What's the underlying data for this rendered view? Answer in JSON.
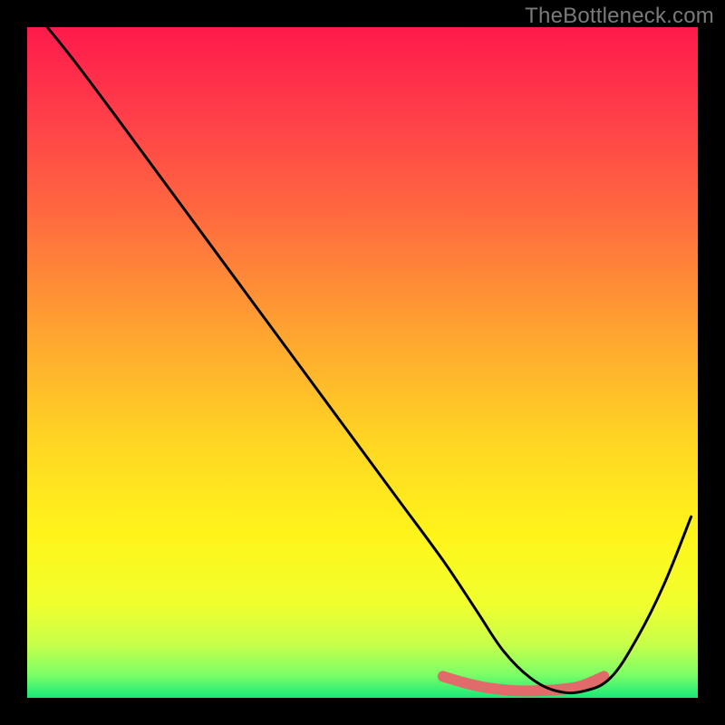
{
  "watermark": "TheBottleneck.com",
  "chart_data": {
    "type": "line",
    "title": "",
    "xlabel": "",
    "ylabel": "",
    "xlim": [
      0,
      100
    ],
    "ylim": [
      0,
      100
    ],
    "curve": {
      "name": "bottleneck-curve",
      "x": [
        3,
        7,
        13,
        20,
        27,
        34,
        41,
        48,
        55,
        62,
        67,
        71,
        75,
        79,
        83,
        87,
        91,
        95,
        99
      ],
      "y": [
        100,
        95,
        87,
        77.5,
        68,
        58.5,
        49,
        39.5,
        30,
        20.5,
        13,
        7,
        3,
        1,
        1,
        3,
        9,
        17,
        27
      ]
    },
    "optimal_band": {
      "name": "optimal-zone",
      "x": [
        62,
        65,
        68,
        71,
        73,
        76,
        79,
        82,
        84,
        86
      ],
      "y": [
        3.2,
        2.3,
        1.6,
        1.2,
        1.05,
        1.05,
        1.2,
        1.6,
        2.3,
        3.2
      ]
    },
    "background_gradient_stops": [
      {
        "offset": 0,
        "color": "#ff1a4b"
      },
      {
        "offset": 12,
        "color": "#ff3b4a"
      },
      {
        "offset": 28,
        "color": "#ff6a3f"
      },
      {
        "offset": 45,
        "color": "#ffa231"
      },
      {
        "offset": 62,
        "color": "#ffd623"
      },
      {
        "offset": 76,
        "color": "#fff51a"
      },
      {
        "offset": 86,
        "color": "#f0ff2e"
      },
      {
        "offset": 92,
        "color": "#c8ff4a"
      },
      {
        "offset": 96.5,
        "color": "#7dff66"
      },
      {
        "offset": 100,
        "color": "#18e879"
      }
    ],
    "styles": {
      "curve_color": "#000000",
      "curve_width": 3,
      "band_color": "#e16a6a",
      "band_width": 12
    }
  }
}
